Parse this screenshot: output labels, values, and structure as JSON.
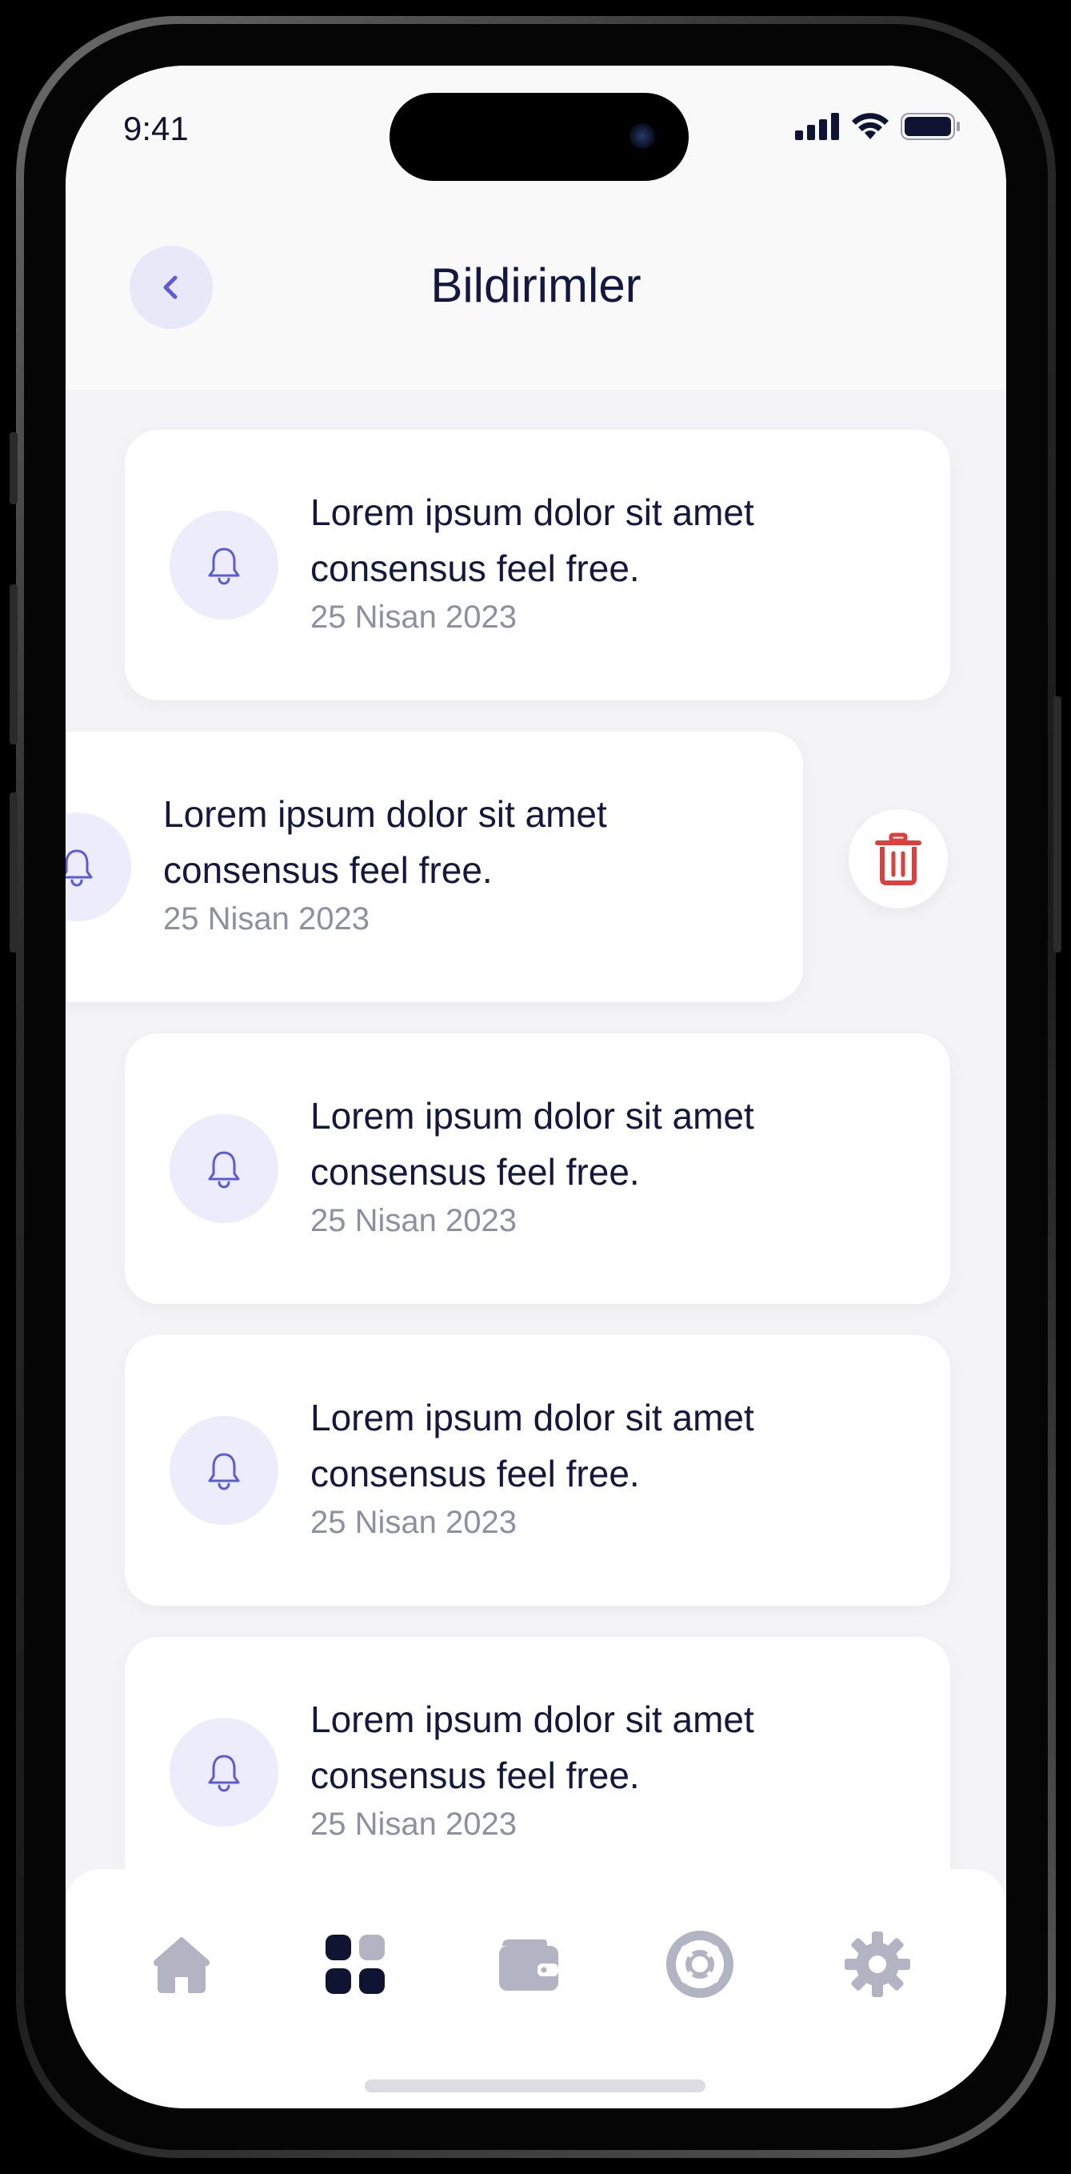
{
  "status_bar": {
    "time": "9:41",
    "icons": [
      "signal-icon",
      "wifi-icon",
      "battery-icon"
    ]
  },
  "header": {
    "title": "Bildirimler",
    "back_icon": "chevron-left-icon"
  },
  "notifications": [
    {
      "title_line1": "Lorem ipsum dolor sit amet",
      "title_line2": "consensus feel free.",
      "date": "25 Nisan 2023",
      "icon": "bell-icon",
      "swiped": false
    },
    {
      "title_line1": "Lorem ipsum dolor sit amet",
      "title_line2": "consensus feel free.",
      "date": "25 Nisan 2023",
      "icon": "bell-icon",
      "swiped": true,
      "action_icon": "trash-icon"
    },
    {
      "title_line1": "Lorem ipsum dolor sit amet",
      "title_line2": "consensus feel free.",
      "date": "25 Nisan 2023",
      "icon": "bell-icon",
      "swiped": false
    },
    {
      "title_line1": "Lorem ipsum dolor sit amet",
      "title_line2": "consensus feel free.",
      "date": "25 Nisan 2023",
      "icon": "bell-icon",
      "swiped": false
    },
    {
      "title_line1": "Lorem ipsum dolor sit amet",
      "title_line2": "consensus feel free.",
      "date": "25 Nisan 2023",
      "icon": "bell-icon",
      "swiped": false
    }
  ],
  "tabbar": {
    "items": [
      {
        "icon": "home-icon",
        "active": false
      },
      {
        "icon": "grid-icon",
        "active": true
      },
      {
        "icon": "wallet-icon",
        "active": false
      },
      {
        "icon": "lifebuoy-icon",
        "active": false
      },
      {
        "icon": "gear-icon",
        "active": false
      }
    ]
  },
  "colors": {
    "accent": "#5a5bd8",
    "title_text": "#14183e",
    "muted_text": "#8e90a2",
    "bell_bg": "#ececfb",
    "delete_red": "#d9403e",
    "tab_inactive": "#b3b4c3",
    "tab_active": "#0f1433"
  }
}
